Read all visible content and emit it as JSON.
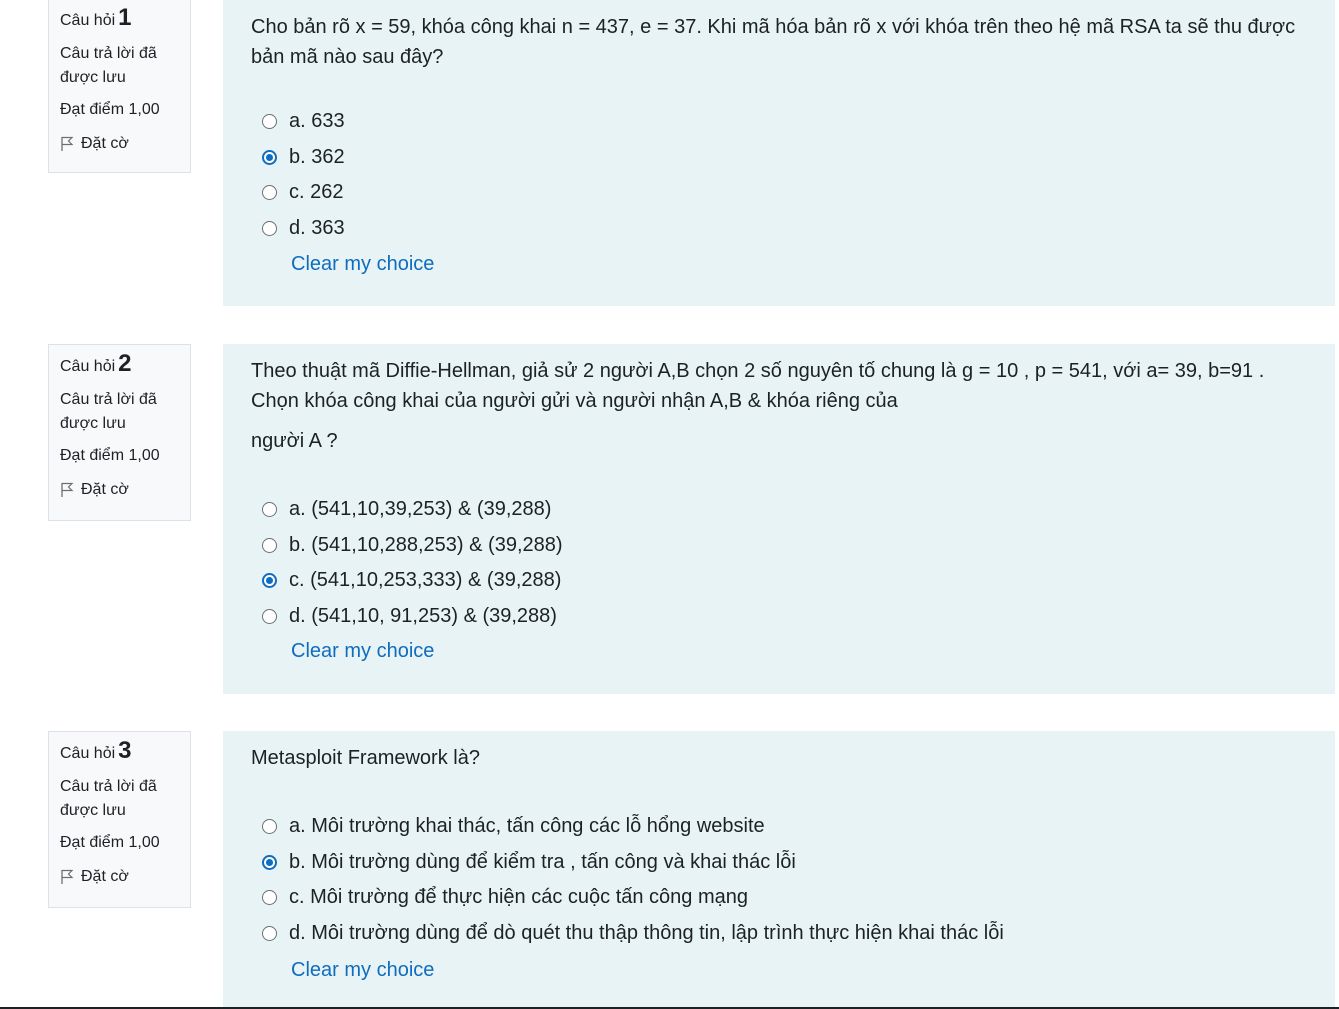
{
  "questions": [
    {
      "label": "Câu hỏi",
      "number": "1",
      "state": "Câu trả lời đã được lưu",
      "grade": "Đạt điểm 1,00",
      "flag": "Đặt cờ",
      "text": [
        "Cho bản rõ x = 59, khóa công khai n = 437, e = 37. Khi mã hóa bản rõ x với khóa trên theo hệ mã RSA ta sẽ thu được bản mã nào sau đây?"
      ],
      "options": [
        "a. 633",
        "b. 362",
        "c. 262",
        "d. 363"
      ],
      "selected": 1,
      "clear": "Clear my choice"
    },
    {
      "label": "Câu hỏi",
      "number": "2",
      "state": "Câu trả lời đã được lưu",
      "grade": "Đạt điểm 1,00",
      "flag": "Đặt cờ",
      "text": [
        "Theo thuật mã Diffie-Hellman, giả sử 2 người A,B chọn 2 số nguyên tố chung là g = 10 , p = 541, với a= 39, b=91 . Chọn khóa công khai của người gửi và người nhận A,B & khóa riêng của",
        "người A ?"
      ],
      "options": [
        "a. (541,10,39,253) & (39,288)",
        "b. (541,10,288,253) & (39,288)",
        "c. (541,10,253,333) & (39,288)",
        "d. (541,10, 91,253) & (39,288)"
      ],
      "selected": 2,
      "clear": "Clear my choice"
    },
    {
      "label": "Câu hỏi",
      "number": "3",
      "state": "Câu trả lời đã được lưu",
      "grade": "Đạt điểm 1,00",
      "flag": "Đặt cờ",
      "text": [
        "Metasploit Framework là?"
      ],
      "options": [
        "a. Môi trường khai thác, tấn công các lỗ hổng website",
        "b. Môi trường dùng để kiểm tra , tấn công và khai thác lỗi",
        "c. Môi trường để thực hiện các cuộc tấn công mạng",
        "d. Môi trường dùng để dò quét thu thập thông tin, lập trình thực hiện khai thác lỗi"
      ],
      "selected": 1,
      "clear": "Clear my choice"
    }
  ],
  "colors": {
    "content_bg": "#e7f3f5",
    "info_bg": "#f8f9fa",
    "link": "#0f6cbf",
    "radio_checked": "#0f6cbf"
  }
}
